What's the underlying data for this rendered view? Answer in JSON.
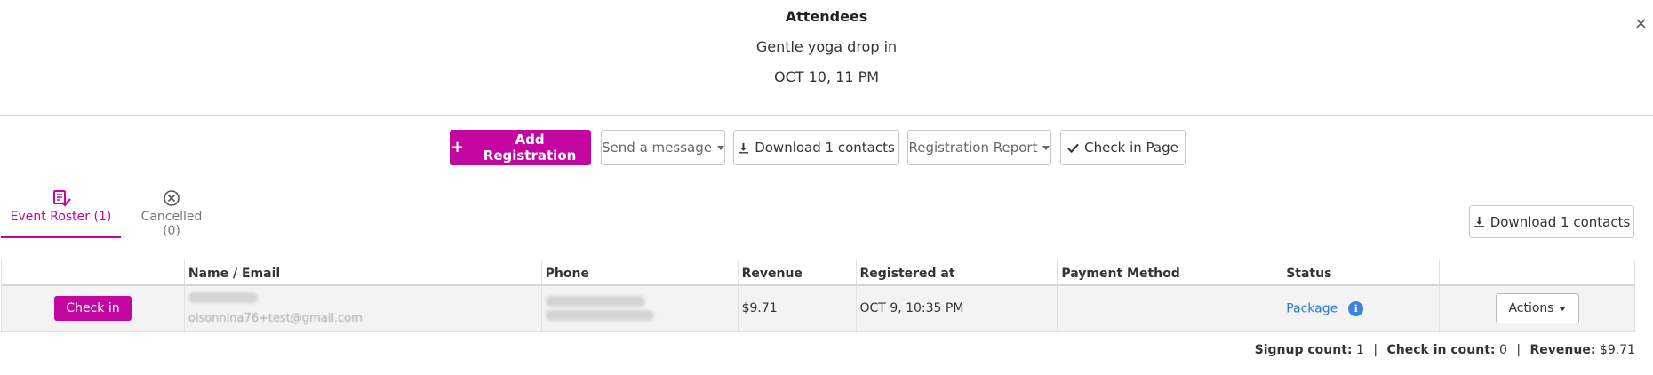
{
  "header": {
    "title": "Attendees",
    "event_name": "Gentle yoga drop in",
    "event_date": "OCT 10, 11 PM",
    "close_label": "×"
  },
  "toolbar": {
    "add_registration": "Add Registration",
    "send_message": "Send a message",
    "download_contacts": "Download 1 contacts",
    "registration_report": "Registration Report",
    "check_in_page": "Check in Page"
  },
  "tabs": [
    {
      "label": "Event Roster (1)",
      "icon": "roster-check-icon",
      "active": true
    },
    {
      "label": "Cancelled (0)",
      "icon": "circle-x-icon",
      "active": false
    }
  ],
  "download_right": "Download 1 contacts",
  "table": {
    "columns": [
      "",
      "Name / Email",
      "Phone",
      "Revenue",
      "Registered at",
      "Payment Method",
      "Status",
      ""
    ],
    "rows": [
      {
        "action": "Check in",
        "email": "olsonnina76+test@gmail.com",
        "revenue": "$9.71",
        "registered_at": "OCT 9, 10:35 PM",
        "payment_method": "",
        "status": "Package",
        "actions_label": "Actions"
      }
    ]
  },
  "summary": {
    "signup_label": "Signup count:",
    "signup_value": "1",
    "checkin_label": "Check in count:",
    "checkin_value": "0",
    "revenue_label": "Revenue:",
    "revenue_value": "$9.71",
    "separator": "|"
  },
  "colors": {
    "accent": "#c3069f",
    "link": "#2b7bd6"
  }
}
